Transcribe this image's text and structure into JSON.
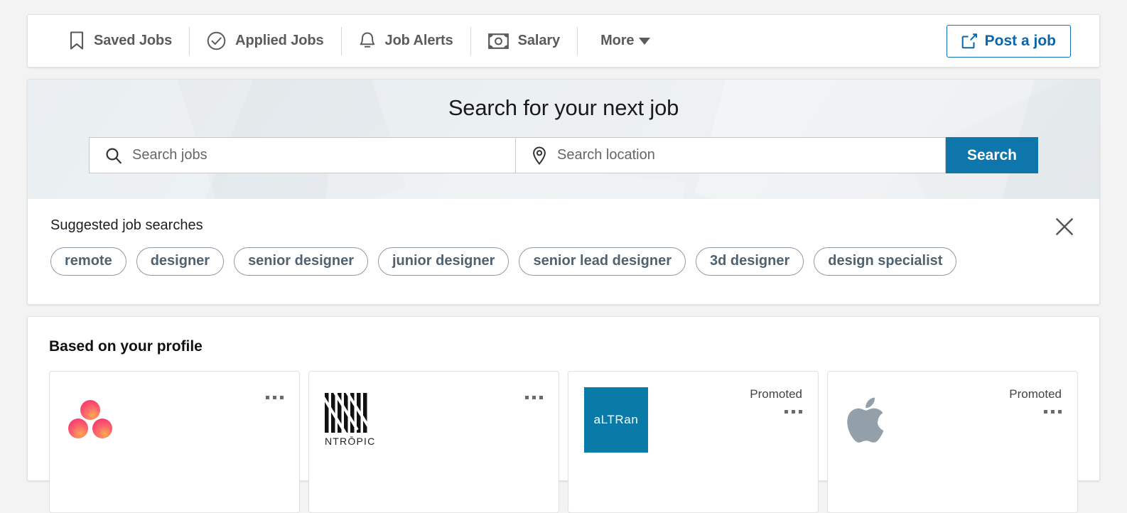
{
  "nav": {
    "items": [
      {
        "label": "Saved Jobs",
        "icon": "bookmark-icon"
      },
      {
        "label": "Applied Jobs",
        "icon": "check-circle-icon"
      },
      {
        "label": "Job Alerts",
        "icon": "bell-icon"
      },
      {
        "label": "Salary",
        "icon": "banknote-icon"
      },
      {
        "label": "More",
        "icon": "chevron-down-icon"
      }
    ],
    "post_job_label": "Post a job",
    "post_job_icon": "edit-square-icon",
    "accent_color": "#0a66a8"
  },
  "hero": {
    "title": "Search for your next job",
    "job_input": {
      "placeholder": "Search jobs",
      "value": "",
      "icon": "search-icon"
    },
    "location_input": {
      "placeholder": "Search location",
      "value": "",
      "icon": "location-pin-icon"
    },
    "search_button": "Search",
    "search_button_color": "#0e76ab",
    "background_color": "#e9eef1"
  },
  "suggested": {
    "title": "Suggested job searches",
    "close_icon": "close-icon",
    "chips": [
      "remote",
      "designer",
      "senior designer",
      "junior designer",
      "senior lead designer",
      "3d designer",
      "design specialist"
    ],
    "chip_color": "#50616f"
  },
  "profile": {
    "title": "Based on your profile",
    "menu_icon": "more-horizontal-icon",
    "cards": [
      {
        "company": "Asana",
        "logo": "asana-logo",
        "promoted": ""
      },
      {
        "company": "Ntropic",
        "logo": "ntropic-logo",
        "wordmark": "NTRŌPIC",
        "promoted": ""
      },
      {
        "company": "Altran",
        "logo": "altran-logo",
        "wordmark": "aLTRan",
        "promoted": "Promoted"
      },
      {
        "company": "Apple",
        "logo": "apple-logo",
        "promoted": "Promoted"
      }
    ]
  }
}
